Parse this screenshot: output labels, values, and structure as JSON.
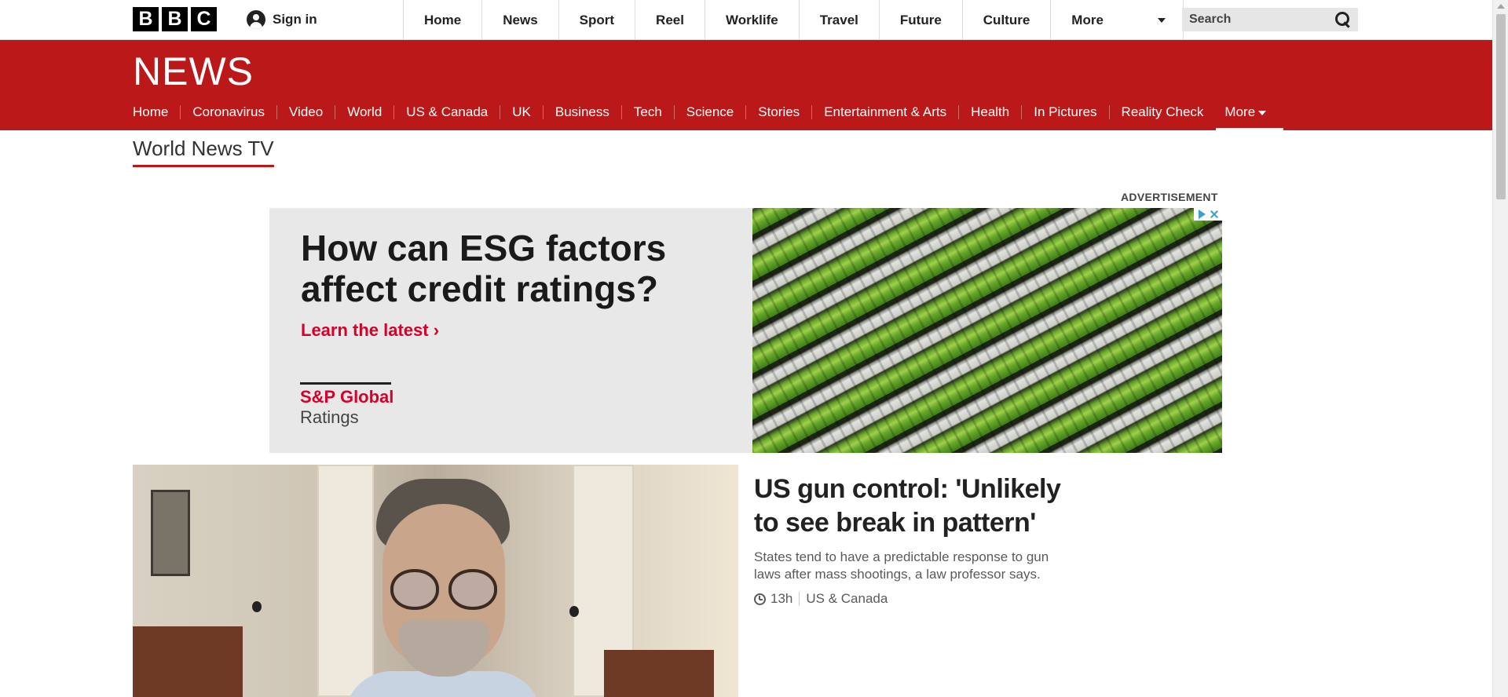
{
  "topbar": {
    "logo_letters": [
      "B",
      "B",
      "C"
    ],
    "signin_label": "Sign in",
    "nav": [
      "Home",
      "News",
      "Sport",
      "Reel",
      "Worklife",
      "Travel",
      "Future",
      "Culture"
    ],
    "more_label": "More",
    "search_placeholder": "Search"
  },
  "newsband": {
    "logo": "NEWS",
    "nav": [
      "Home",
      "Coronavirus",
      "Video",
      "World",
      "US & Canada",
      "UK",
      "Business",
      "Tech",
      "Science",
      "Stories",
      "Entertainment & Arts",
      "Health",
      "In Pictures",
      "Reality Check"
    ],
    "more_label": "More"
  },
  "section": {
    "title": "World News TV"
  },
  "ad": {
    "label": "ADVERTISEMENT",
    "headline": "How can ESG factors affect credit ratings?",
    "cta": "Learn the latest ›",
    "brand_line1": "S&P Global",
    "brand_line2": "Ratings"
  },
  "story": {
    "title": "US gun control: 'Unlikely to see break in pattern'",
    "summary": "States tend to have a predictable response to gun laws after mass shootings, a law professor says.",
    "time": "13h",
    "category": "US & Canada"
  },
  "colors": {
    "brand_red": "#bb1919",
    "ad_red": "#d6002a"
  }
}
